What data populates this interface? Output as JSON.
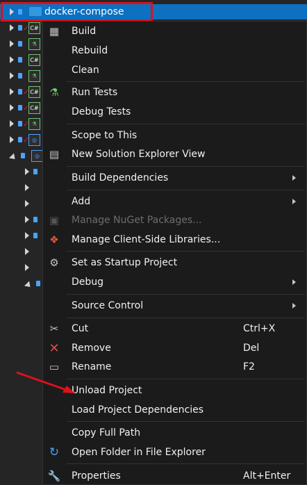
{
  "tree": {
    "selected_label": "docker-compose"
  },
  "menu": {
    "items": [
      {
        "label": "Build",
        "icon": "build-icon"
      },
      {
        "label": "Rebuild"
      },
      {
        "label": "Clean"
      },
      {
        "label": "Run Tests",
        "icon": "flask-icon"
      },
      {
        "label": "Debug Tests"
      },
      {
        "label": "Scope to This"
      },
      {
        "label": "New Solution Explorer View",
        "icon": "solution-view-icon"
      },
      {
        "label": "Build Dependencies",
        "submenu": true
      },
      {
        "label": "Add",
        "submenu": true
      },
      {
        "label": "Manage NuGet Packages...",
        "icon": "nuget-icon",
        "disabled": true
      },
      {
        "label": "Manage Client-Side Libraries...",
        "icon": "libraries-icon"
      },
      {
        "label": "Set as Startup Project",
        "icon": "gear-icon"
      },
      {
        "label": "Debug",
        "submenu": true
      },
      {
        "label": "Source Control",
        "submenu": true
      },
      {
        "label": "Cut",
        "icon": "scissors-icon",
        "shortcut": "Ctrl+X"
      },
      {
        "label": "Remove",
        "icon": "close-icon",
        "shortcut": "Del"
      },
      {
        "label": "Rename",
        "icon": "rename-icon",
        "shortcut": "F2"
      },
      {
        "label": "Unload Project"
      },
      {
        "label": "Load Project Dependencies"
      },
      {
        "label": "Copy Full Path"
      },
      {
        "label": "Open Folder in File Explorer",
        "icon": "refresh-arrow-icon"
      },
      {
        "label": "Properties",
        "icon": "wrench-icon",
        "shortcut": "Alt+Enter"
      }
    ]
  },
  "colors": {
    "selection": "#0e70c0",
    "highlight_border": "#e0101a",
    "annotation_arrow": "#e0101a"
  }
}
